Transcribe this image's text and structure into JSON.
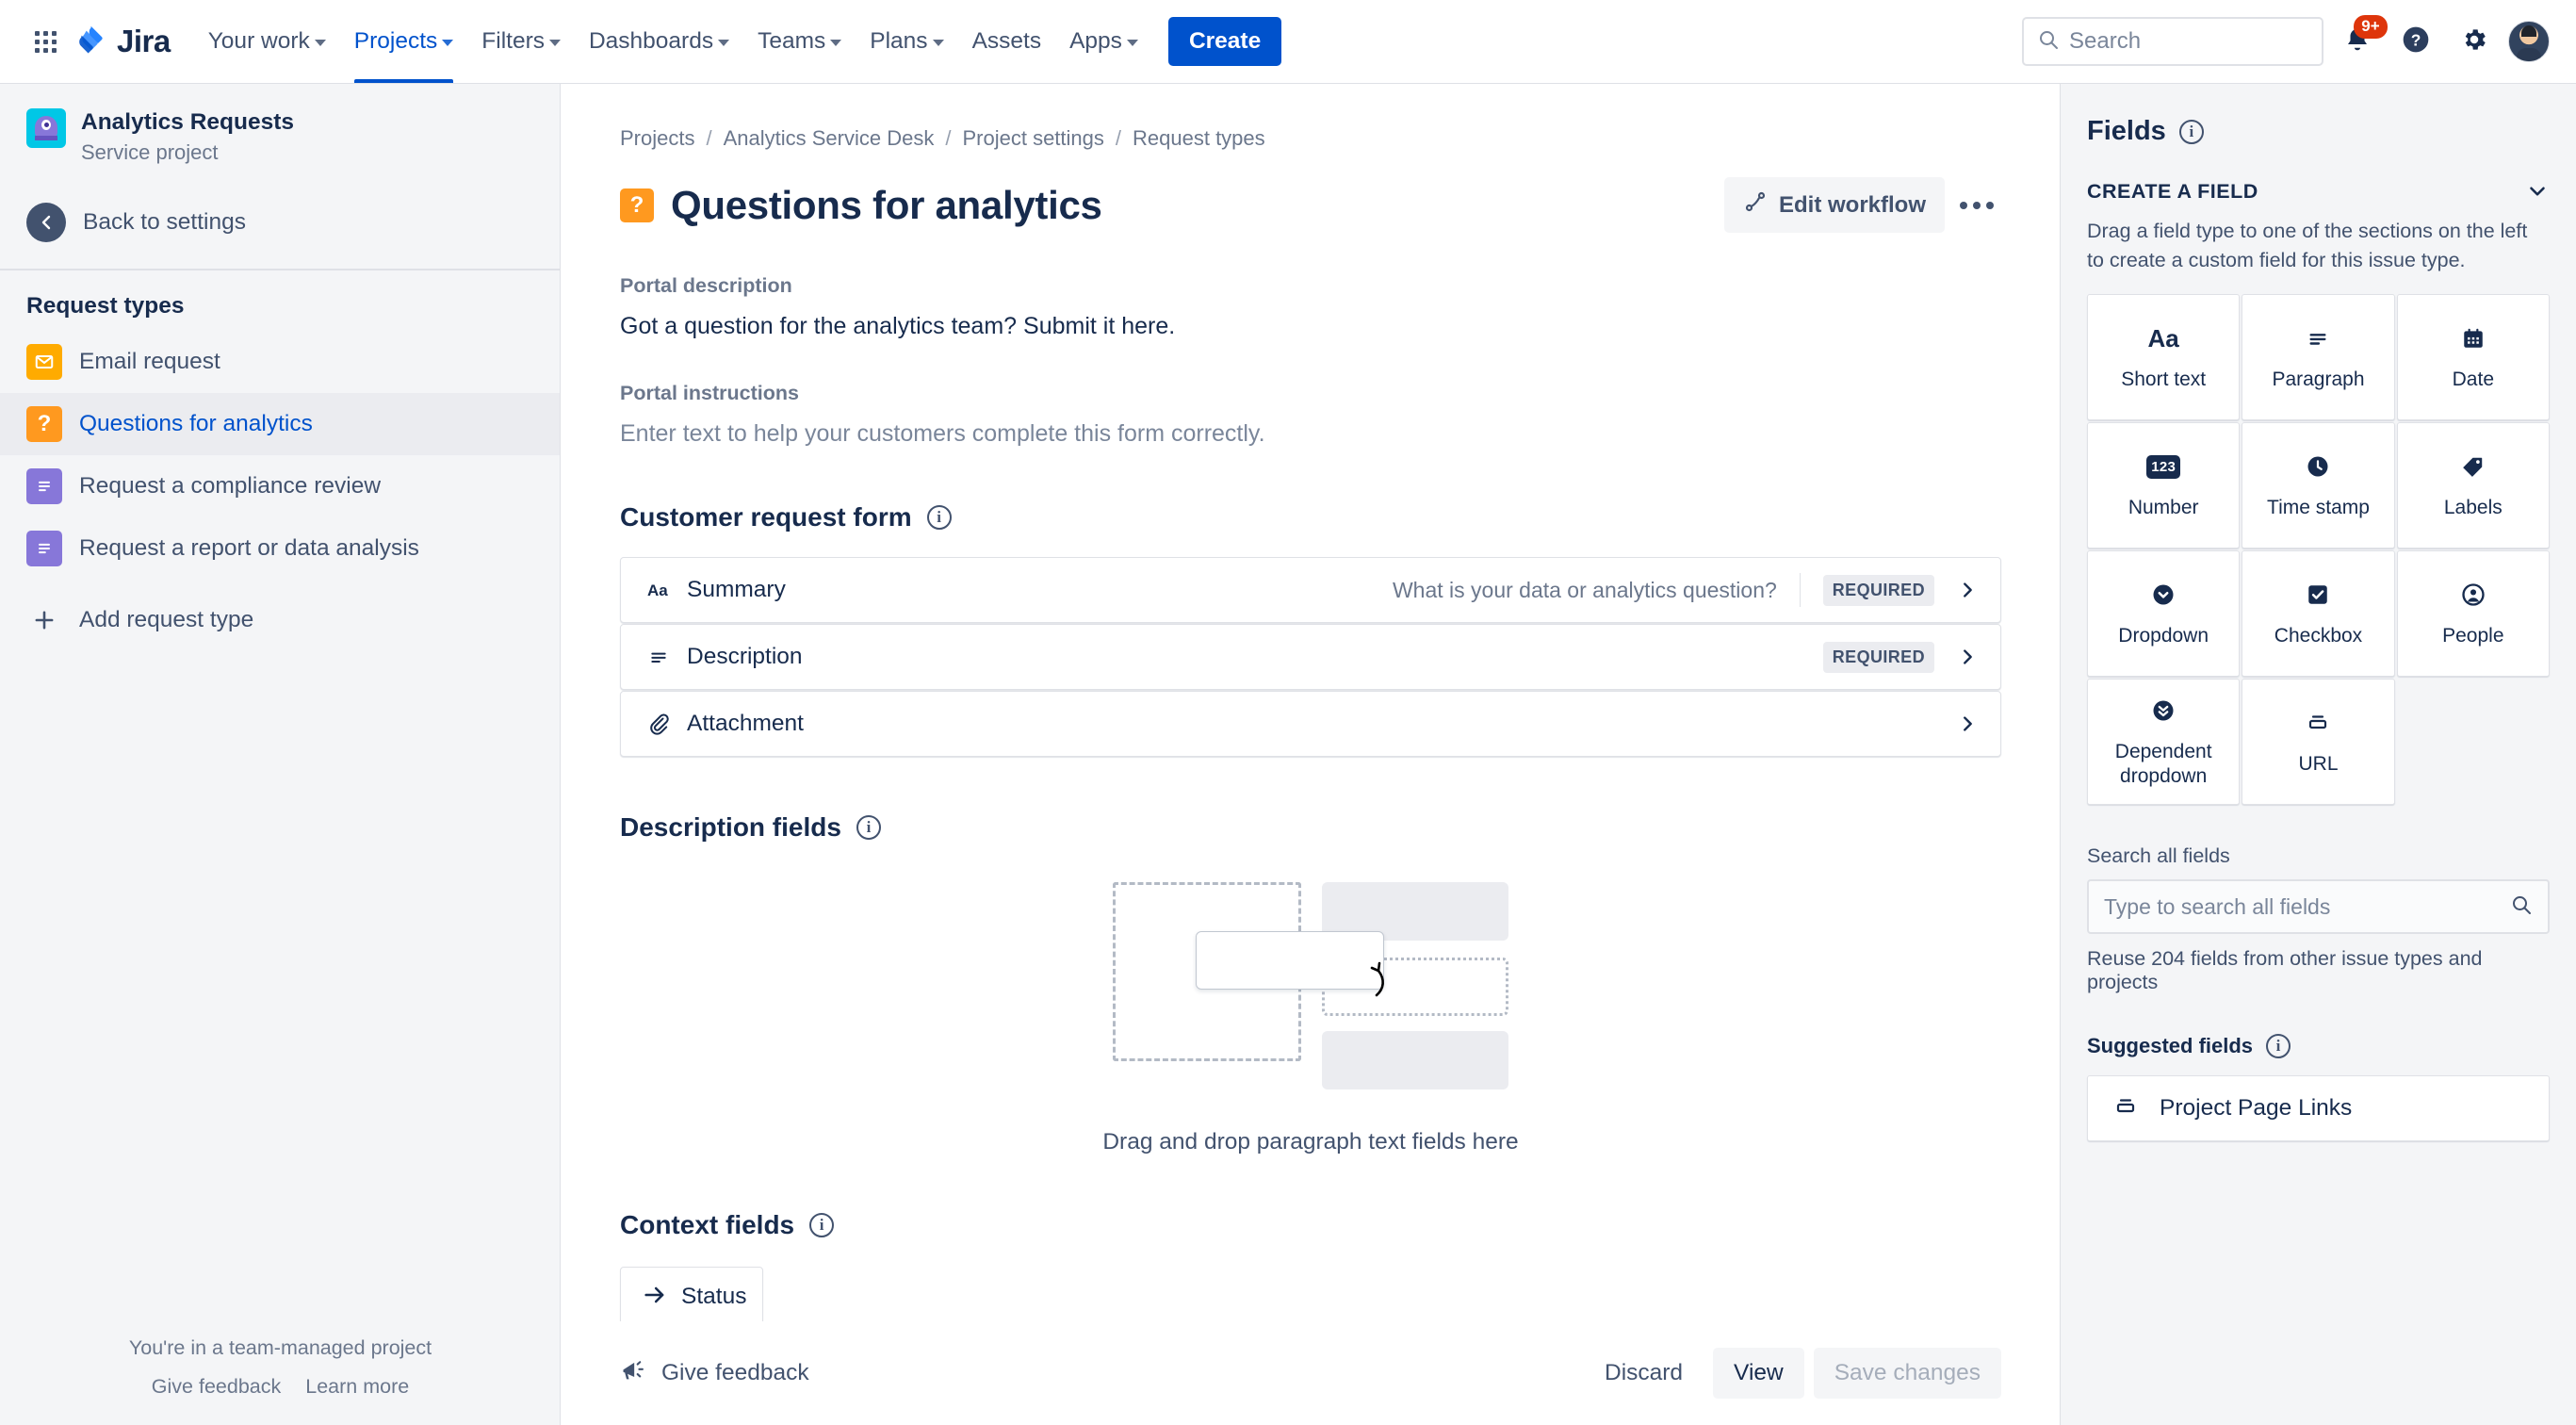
{
  "topnav": {
    "brand": "Jira",
    "items": [
      {
        "label": "Your work",
        "caret": true,
        "active": false
      },
      {
        "label": "Projects",
        "caret": true,
        "active": true
      },
      {
        "label": "Filters",
        "caret": true,
        "active": false
      },
      {
        "label": "Dashboards",
        "caret": true,
        "active": false
      },
      {
        "label": "Teams",
        "caret": true,
        "active": false
      },
      {
        "label": "Plans",
        "caret": true,
        "active": false
      },
      {
        "label": "Assets",
        "caret": false,
        "active": false
      },
      {
        "label": "Apps",
        "caret": true,
        "active": false
      }
    ],
    "create_label": "Create",
    "search_placeholder": "Search",
    "notification_badge": "9+",
    "icons": [
      "search-icon",
      "notifications-icon",
      "help-icon",
      "settings-icon",
      "avatar"
    ]
  },
  "sidebar": {
    "project_name": "Analytics Requests",
    "project_type": "Service project",
    "back_label": "Back to settings",
    "section_title": "Request types",
    "request_types": [
      {
        "label": "Email request",
        "icon": "envelope-icon",
        "color": "orange",
        "selected": false
      },
      {
        "label": "Questions for analytics",
        "icon": "question-mark-icon",
        "color": "qmark",
        "selected": true
      },
      {
        "label": "Request a compliance review",
        "icon": "paragraph-icon",
        "color": "purple",
        "selected": false
      },
      {
        "label": "Request a report or data analysis",
        "icon": "paragraph-icon",
        "color": "purple",
        "selected": false
      }
    ],
    "add_request_type": "Add request type",
    "footer_line1": "You're in a team-managed project",
    "footer_give_feedback": "Give feedback",
    "footer_learn_more": "Learn more"
  },
  "main": {
    "breadcrumbs": [
      "Projects",
      "Analytics Service Desk",
      "Project settings",
      "Request types"
    ],
    "title": "Questions for analytics",
    "edit_workflow_label": "Edit workflow",
    "portal_description_label": "Portal description",
    "portal_description_value": "Got a question for the analytics team? Submit it here.",
    "portal_instructions_label": "Portal instructions",
    "portal_instructions_value": "Enter text to help your customers complete this form correctly.",
    "customer_request_form_title": "Customer request form",
    "form_rows": [
      {
        "name": "Summary",
        "icon": "short-text-icon",
        "description": "What is your data or analytics question?",
        "badge": "REQUIRED"
      },
      {
        "name": "Description",
        "icon": "paragraph-icon",
        "description": "",
        "badge": "REQUIRED"
      },
      {
        "name": "Attachment",
        "icon": "paperclip-icon",
        "description": "",
        "badge": ""
      }
    ],
    "description_fields_title": "Description fields",
    "dropzone_text": "Drag and drop paragraph text fields here",
    "context_fields_title": "Context fields",
    "context_fields": [
      {
        "label": "Status",
        "icon": "arrow-right-icon"
      }
    ],
    "bottom_bar": {
      "give_feedback": "Give feedback",
      "discard": "Discard",
      "view": "View",
      "save_changes": "Save changes"
    }
  },
  "right_panel": {
    "title": "Fields",
    "create_a_field_label": "CREATE A FIELD",
    "create_a_field_desc": "Drag a field type to one of the sections on the left to create a custom field for this issue type.",
    "field_types": [
      {
        "label": "Short text",
        "icon": "short-text-icon"
      },
      {
        "label": "Paragraph",
        "icon": "paragraph-icon"
      },
      {
        "label": "Date",
        "icon": "calendar-icon"
      },
      {
        "label": "Number",
        "icon": "number-icon"
      },
      {
        "label": "Time stamp",
        "icon": "clock-icon"
      },
      {
        "label": "Labels",
        "icon": "tag-icon"
      },
      {
        "label": "Dropdown",
        "icon": "chevron-down-circle-icon"
      },
      {
        "label": "Checkbox",
        "icon": "checkbox-icon"
      },
      {
        "label": "People",
        "icon": "person-icon"
      },
      {
        "label": "Dependent dropdown",
        "icon": "double-chevron-down-circle-icon"
      },
      {
        "label": "URL",
        "icon": "url-icon"
      }
    ],
    "search_all_fields_label": "Search all fields",
    "search_all_fields_placeholder": "Type to search all fields",
    "reuse_note": "Reuse 204 fields from other issue types and projects",
    "suggested_fields_label": "Suggested fields",
    "suggested_fields": [
      {
        "label": "Project Page Links",
        "icon": "url-icon"
      }
    ]
  },
  "colors": {
    "brand_blue": "#0052CC",
    "badge_red": "#DE350B",
    "orange": "#FFAB00",
    "purple": "#8777D9",
    "text": "#172B4D",
    "subtle_text": "#6B778C"
  }
}
